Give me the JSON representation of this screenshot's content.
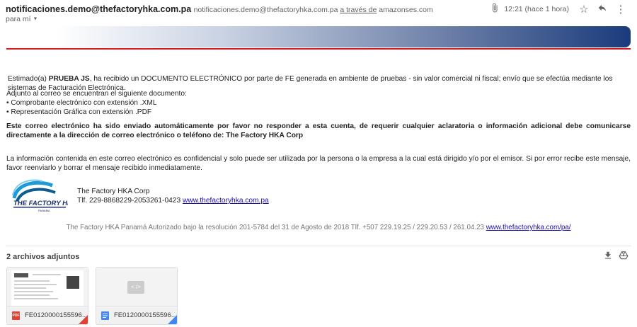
{
  "header": {
    "sender_name": "notificaciones.demo@thefactoryhka.com.pa",
    "sender_email": "notificaciones.demo@thefactoryhka.com.pa",
    "via_label": "a través de",
    "via_domain": "amazonses.com",
    "to_label": "para mí",
    "time": "12:21 (hace 1 hora)"
  },
  "body": {
    "greeting_pre": "Estimado(a) ",
    "recipient": "PRUEBA JS",
    "greeting_post": ", ha recibido un DOCUMENTO ELECTRÓNICO por parte de FE generada en ambiente de pruebas - sin valor comercial ni fiscal; envío que se efectúa mediante los sistemas de Facturación Electrónica.",
    "attach_intro": "Adjunto al correo se encuentran el siguiente documento:",
    "attach_items": [
      "• Comprobante electrónico con extensión .XML",
      "• Representación Gráfica con extensión .PDF"
    ],
    "notice": "Este correo electrónico ha sido enviado automáticamente por favor no responder a esta cuenta, de requerir cualquier aclaratoria o información adicional debe comunicarse directamente a la dirección de correo electrónico o teléfono de: The Factory HKA Corp",
    "confidential": "La información contenida en este correo electrónico es confidencial y solo puede ser utilizada por la persona o la empresa a la cual está dirigido y/o por el emisor. Si por error recibe este mensaje, favor reenviarlo y borrar el mensaje recibido inmediatamente."
  },
  "signature": {
    "logo_text": "THE FACTORY HKA",
    "logo_sub": "PANAMA",
    "company": "The Factory HKA Corp",
    "phone": "Tlf. 229-8868229-2053261-0423",
    "link": "www.thefactoryhka.com.pa"
  },
  "footer": {
    "text": "The Factory HKA Panamá Autorizado bajo la resolución 201-5784 del 31 de Agosto de 2018 Tlf. +507 229.19.25 / 229.20.53 / 261.04.23",
    "link": "www.thefactoryhka.com/pa/"
  },
  "attachments": {
    "title": "2 archivos adjuntos",
    "files": [
      {
        "name": "FE0120000155596...",
        "type_label": "PDF",
        "color": "#db4437"
      },
      {
        "name": "FE0120000155596...",
        "type_label": "",
        "color": "#4285f4"
      }
    ],
    "xml_placeholder": "< />"
  },
  "colors": {
    "accent_red": "#d71920",
    "banner_blue": "#1a3b7c",
    "link": "#1a0dab"
  }
}
